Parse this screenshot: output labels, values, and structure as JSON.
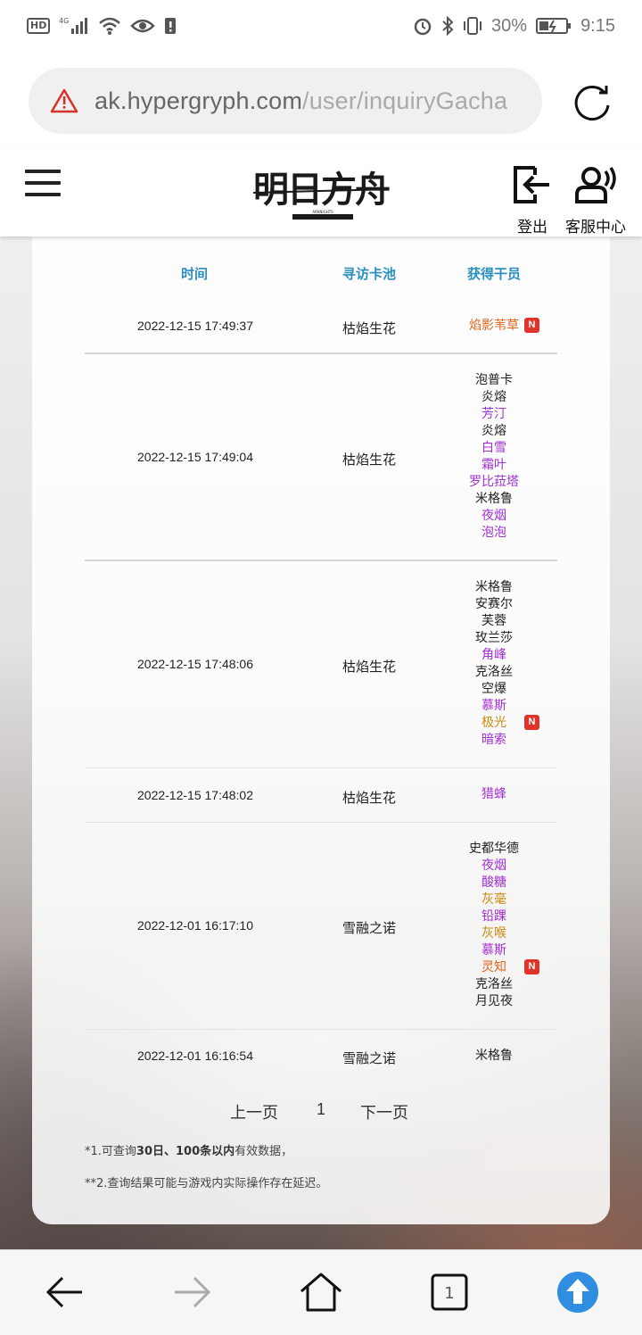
{
  "status_bar": {
    "left_badge": "HD",
    "network": "4G",
    "battery_percent": "30%",
    "time": "9:15"
  },
  "browser": {
    "url_host": "ak.hypergryph.com",
    "url_path": "/user/inquiryGacha"
  },
  "header": {
    "logo_text": "明日方舟",
    "logo_subtext": "ARKNIGHTS",
    "logout_label": "登出",
    "service_label": "客服中心"
  },
  "table": {
    "headers": {
      "time": "时间",
      "pool": "寻访卡池",
      "char": "获得干员"
    },
    "rows": [
      {
        "time": "2022-12-15 17:49:37",
        "pool": "枯焰生花",
        "chars": [
          {
            "name": "焰影苇草",
            "color": "orange",
            "new": true
          }
        ]
      },
      {
        "time": "2022-12-15 17:49:04",
        "pool": "枯焰生花",
        "chars": [
          {
            "name": "泡普卡",
            "color": "black",
            "new": false
          },
          {
            "name": "炎熔",
            "color": "black",
            "new": false
          },
          {
            "name": "芳汀",
            "color": "purple",
            "new": false
          },
          {
            "name": "炎熔",
            "color": "black",
            "new": false
          },
          {
            "name": "白雪",
            "color": "purple",
            "new": false
          },
          {
            "name": "霜叶",
            "color": "purple",
            "new": false
          },
          {
            "name": "罗比菈塔",
            "color": "purple",
            "new": false
          },
          {
            "name": "米格鲁",
            "color": "black",
            "new": false
          },
          {
            "name": "夜烟",
            "color": "purple",
            "new": false
          },
          {
            "name": "泡泡",
            "color": "purple",
            "new": false
          }
        ]
      },
      {
        "time": "2022-12-15 17:48:06",
        "pool": "枯焰生花",
        "chars": [
          {
            "name": "米格鲁",
            "color": "black",
            "new": false
          },
          {
            "name": "安赛尔",
            "color": "black",
            "new": false
          },
          {
            "name": "芙蓉",
            "color": "black",
            "new": false
          },
          {
            "name": "玫兰莎",
            "color": "black",
            "new": false
          },
          {
            "name": "角峰",
            "color": "purple",
            "new": false
          },
          {
            "name": "克洛丝",
            "color": "black",
            "new": false
          },
          {
            "name": "空爆",
            "color": "black",
            "new": false
          },
          {
            "name": "慕斯",
            "color": "purple",
            "new": false
          },
          {
            "name": "极光",
            "color": "gold",
            "new": true
          },
          {
            "name": "暗索",
            "color": "purple",
            "new": false
          }
        ]
      },
      {
        "time": "2022-12-15 17:48:02",
        "pool": "枯焰生花",
        "chars": [
          {
            "name": "猎蜂",
            "color": "purple",
            "new": false
          }
        ]
      },
      {
        "time": "2022-12-01 16:17:10",
        "pool": "雪融之诺",
        "chars": [
          {
            "name": "史都华德",
            "color": "black",
            "new": false
          },
          {
            "name": "夜烟",
            "color": "purple",
            "new": false
          },
          {
            "name": "酸糖",
            "color": "purple",
            "new": false
          },
          {
            "name": "灰毫",
            "color": "gold",
            "new": false
          },
          {
            "name": "铅踝",
            "color": "purple",
            "new": false
          },
          {
            "name": "灰喉",
            "color": "gold",
            "new": false
          },
          {
            "name": "慕斯",
            "color": "purple",
            "new": false
          },
          {
            "name": "灵知",
            "color": "orange",
            "new": true
          },
          {
            "name": "克洛丝",
            "color": "black",
            "new": false
          },
          {
            "name": "月见夜",
            "color": "black",
            "new": false
          }
        ]
      },
      {
        "time": "2022-12-01 16:16:54",
        "pool": "雪融之诺",
        "chars": [
          {
            "name": "米格鲁",
            "color": "black",
            "new": false
          }
        ]
      }
    ],
    "new_badge": "N"
  },
  "pagination": {
    "prev": "上一页",
    "page": "1",
    "next": "下一页"
  },
  "notes": {
    "note1_prefix": "*1.可查询",
    "note1_bold": "30日、100条以内",
    "note1_suffix": "有效数据，",
    "note2": "**2.查询结果可能与游戏内实际操作存在延迟。"
  },
  "bottom_nav": {
    "tab_count": "1",
    "accent_color": "#2f8ee0"
  },
  "colors": {
    "black": "#222222",
    "purple": "#a12fd3",
    "gold": "#c9890d",
    "orange": "#e0641f",
    "header_blue": "#2a8fc0",
    "new_red": "#e0332a"
  }
}
